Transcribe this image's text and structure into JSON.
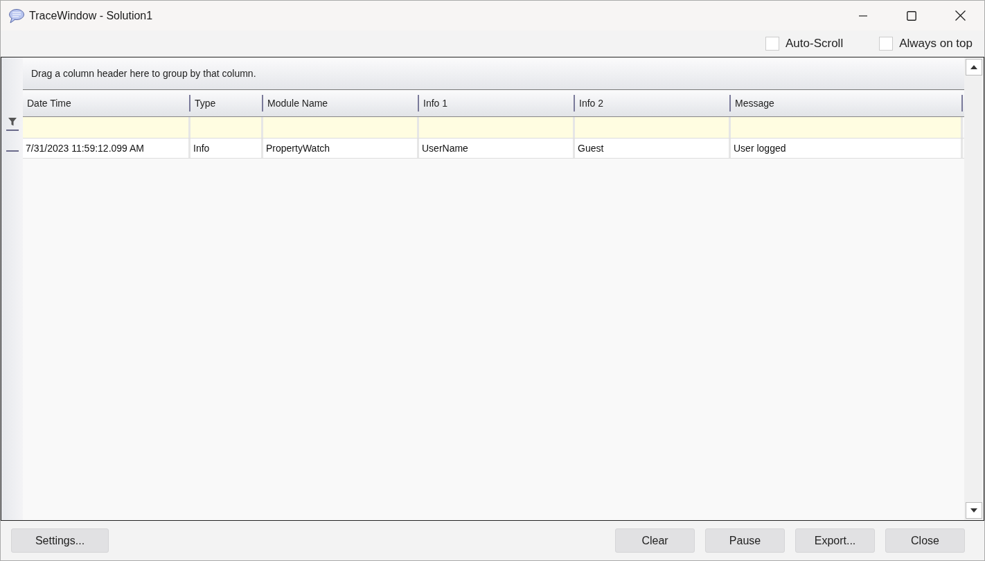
{
  "window": {
    "title": "TraceWindow - Solution1"
  },
  "options": [
    {
      "label": "Auto-Scroll",
      "checked": false
    },
    {
      "label": "Always on top",
      "checked": false
    }
  ],
  "grid": {
    "group_hint": "Drag a column header here to group by that column.",
    "columns": [
      "Date Time",
      "Type",
      "Module Name",
      "Info 1",
      "Info 2",
      "Message"
    ],
    "rows": [
      {
        "cells": [
          "7/31/2023 11:59:12.099 AM",
          "Info",
          "PropertyWatch",
          "UserName",
          "Guest",
          "User logged"
        ]
      }
    ]
  },
  "buttons_left": [
    "Settings..."
  ],
  "buttons_right": [
    "Clear",
    "Pause",
    "Export...",
    "Close"
  ]
}
